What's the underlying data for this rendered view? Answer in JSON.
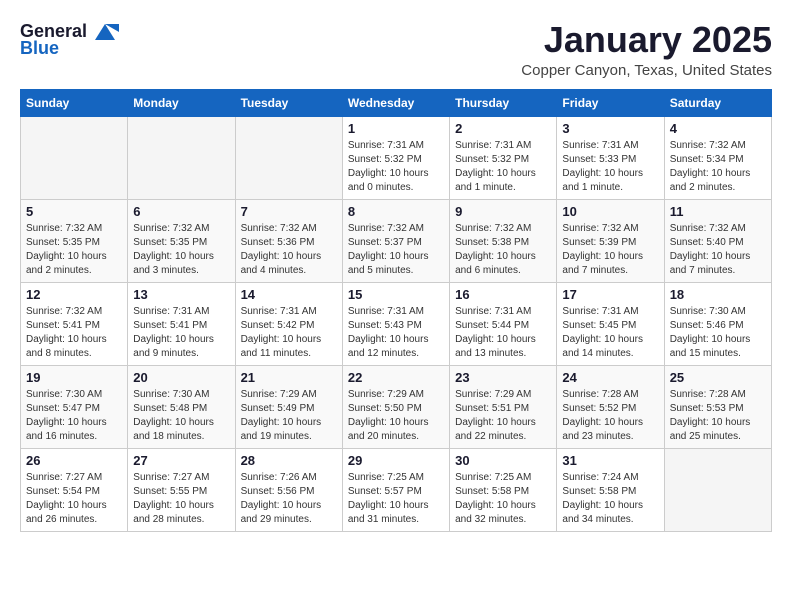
{
  "header": {
    "logo_general": "General",
    "logo_blue": "Blue",
    "title": "January 2025",
    "subtitle": "Copper Canyon, Texas, United States"
  },
  "weekdays": [
    "Sunday",
    "Monday",
    "Tuesday",
    "Wednesday",
    "Thursday",
    "Friday",
    "Saturday"
  ],
  "weeks": [
    [
      {
        "day": "",
        "info": ""
      },
      {
        "day": "",
        "info": ""
      },
      {
        "day": "",
        "info": ""
      },
      {
        "day": "1",
        "info": "Sunrise: 7:31 AM\nSunset: 5:32 PM\nDaylight: 10 hours\nand 0 minutes."
      },
      {
        "day": "2",
        "info": "Sunrise: 7:31 AM\nSunset: 5:32 PM\nDaylight: 10 hours\nand 1 minute."
      },
      {
        "day": "3",
        "info": "Sunrise: 7:31 AM\nSunset: 5:33 PM\nDaylight: 10 hours\nand 1 minute."
      },
      {
        "day": "4",
        "info": "Sunrise: 7:32 AM\nSunset: 5:34 PM\nDaylight: 10 hours\nand 2 minutes."
      }
    ],
    [
      {
        "day": "5",
        "info": "Sunrise: 7:32 AM\nSunset: 5:35 PM\nDaylight: 10 hours\nand 2 minutes."
      },
      {
        "day": "6",
        "info": "Sunrise: 7:32 AM\nSunset: 5:35 PM\nDaylight: 10 hours\nand 3 minutes."
      },
      {
        "day": "7",
        "info": "Sunrise: 7:32 AM\nSunset: 5:36 PM\nDaylight: 10 hours\nand 4 minutes."
      },
      {
        "day": "8",
        "info": "Sunrise: 7:32 AM\nSunset: 5:37 PM\nDaylight: 10 hours\nand 5 minutes."
      },
      {
        "day": "9",
        "info": "Sunrise: 7:32 AM\nSunset: 5:38 PM\nDaylight: 10 hours\nand 6 minutes."
      },
      {
        "day": "10",
        "info": "Sunrise: 7:32 AM\nSunset: 5:39 PM\nDaylight: 10 hours\nand 7 minutes."
      },
      {
        "day": "11",
        "info": "Sunrise: 7:32 AM\nSunset: 5:40 PM\nDaylight: 10 hours\nand 7 minutes."
      }
    ],
    [
      {
        "day": "12",
        "info": "Sunrise: 7:32 AM\nSunset: 5:41 PM\nDaylight: 10 hours\nand 8 minutes."
      },
      {
        "day": "13",
        "info": "Sunrise: 7:31 AM\nSunset: 5:41 PM\nDaylight: 10 hours\nand 9 minutes."
      },
      {
        "day": "14",
        "info": "Sunrise: 7:31 AM\nSunset: 5:42 PM\nDaylight: 10 hours\nand 11 minutes."
      },
      {
        "day": "15",
        "info": "Sunrise: 7:31 AM\nSunset: 5:43 PM\nDaylight: 10 hours\nand 12 minutes."
      },
      {
        "day": "16",
        "info": "Sunrise: 7:31 AM\nSunset: 5:44 PM\nDaylight: 10 hours\nand 13 minutes."
      },
      {
        "day": "17",
        "info": "Sunrise: 7:31 AM\nSunset: 5:45 PM\nDaylight: 10 hours\nand 14 minutes."
      },
      {
        "day": "18",
        "info": "Sunrise: 7:30 AM\nSunset: 5:46 PM\nDaylight: 10 hours\nand 15 minutes."
      }
    ],
    [
      {
        "day": "19",
        "info": "Sunrise: 7:30 AM\nSunset: 5:47 PM\nDaylight: 10 hours\nand 16 minutes."
      },
      {
        "day": "20",
        "info": "Sunrise: 7:30 AM\nSunset: 5:48 PM\nDaylight: 10 hours\nand 18 minutes."
      },
      {
        "day": "21",
        "info": "Sunrise: 7:29 AM\nSunset: 5:49 PM\nDaylight: 10 hours\nand 19 minutes."
      },
      {
        "day": "22",
        "info": "Sunrise: 7:29 AM\nSunset: 5:50 PM\nDaylight: 10 hours\nand 20 minutes."
      },
      {
        "day": "23",
        "info": "Sunrise: 7:29 AM\nSunset: 5:51 PM\nDaylight: 10 hours\nand 22 minutes."
      },
      {
        "day": "24",
        "info": "Sunrise: 7:28 AM\nSunset: 5:52 PM\nDaylight: 10 hours\nand 23 minutes."
      },
      {
        "day": "25",
        "info": "Sunrise: 7:28 AM\nSunset: 5:53 PM\nDaylight: 10 hours\nand 25 minutes."
      }
    ],
    [
      {
        "day": "26",
        "info": "Sunrise: 7:27 AM\nSunset: 5:54 PM\nDaylight: 10 hours\nand 26 minutes."
      },
      {
        "day": "27",
        "info": "Sunrise: 7:27 AM\nSunset: 5:55 PM\nDaylight: 10 hours\nand 28 minutes."
      },
      {
        "day": "28",
        "info": "Sunrise: 7:26 AM\nSunset: 5:56 PM\nDaylight: 10 hours\nand 29 minutes."
      },
      {
        "day": "29",
        "info": "Sunrise: 7:25 AM\nSunset: 5:57 PM\nDaylight: 10 hours\nand 31 minutes."
      },
      {
        "day": "30",
        "info": "Sunrise: 7:25 AM\nSunset: 5:58 PM\nDaylight: 10 hours\nand 32 minutes."
      },
      {
        "day": "31",
        "info": "Sunrise: 7:24 AM\nSunset: 5:58 PM\nDaylight: 10 hours\nand 34 minutes."
      },
      {
        "day": "",
        "info": ""
      }
    ]
  ]
}
